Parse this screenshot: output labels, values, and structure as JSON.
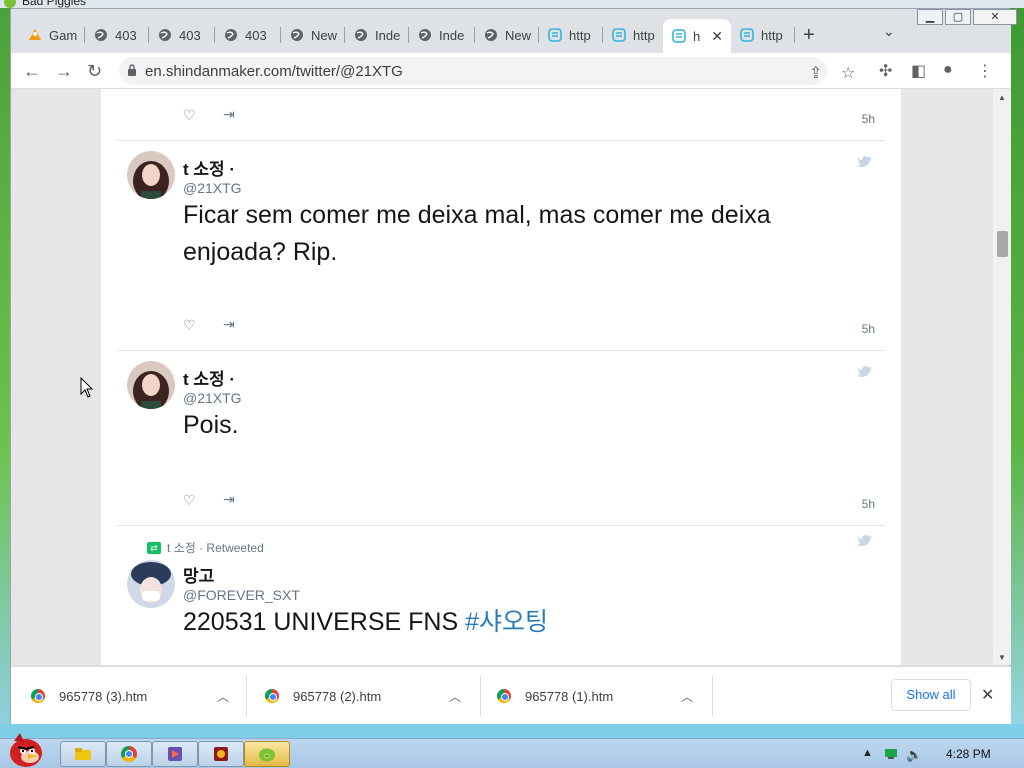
{
  "backdrop": {
    "window_title": "Bad Piggies"
  },
  "browser": {
    "tabs": [
      {
        "label": "Gam",
        "icon": "games-icon"
      },
      {
        "label": "403",
        "icon": "globe-icon"
      },
      {
        "label": "403",
        "icon": "globe-icon"
      },
      {
        "label": "403",
        "icon": "globe-icon"
      },
      {
        "label": "New",
        "icon": "globe-icon"
      },
      {
        "label": "Inde",
        "icon": "globe-icon"
      },
      {
        "label": "Inde",
        "icon": "globe-icon"
      },
      {
        "label": "New",
        "icon": "globe-icon"
      },
      {
        "label": "http",
        "icon": "shindan-icon"
      },
      {
        "label": "http",
        "icon": "shindan-icon"
      },
      {
        "label": "h",
        "icon": "shindan-icon",
        "active": true
      },
      {
        "label": "http",
        "icon": "shindan-icon"
      }
    ],
    "new_tab_label": "+",
    "url": "en.shindanmaker.com/twitter/@21XTG"
  },
  "timeline": {
    "tweets": [
      {
        "time": "5h"
      },
      {
        "name": "t 소정 ·",
        "handle": "@21XTG",
        "text": "Ficar sem comer me deixa mal, mas comer me deixa enjoada? Rip.",
        "time": "5h"
      },
      {
        "name": "t 소정 ·",
        "handle": "@21XTG",
        "text": "Pois.",
        "time": "5h"
      },
      {
        "retweet_label": "t 소정 · Retweeted",
        "name": "망고",
        "handle": "@FOREVER_SXT",
        "text_plain": "220531 UNIVERSE FNS ",
        "text_hashtag": "#샤오팅"
      }
    ]
  },
  "downloads": {
    "items": [
      {
        "filename": "965778 (3).htm"
      },
      {
        "filename": "965778 (2).htm"
      },
      {
        "filename": "965778 (1).htm"
      }
    ],
    "show_all_label": "Show all"
  },
  "taskbar": {
    "clock": "4:28 PM"
  },
  "colors": {
    "link_blue": "#2b7bb9",
    "twitter_gray": "#657786",
    "retweet_green": "#17bf63"
  }
}
